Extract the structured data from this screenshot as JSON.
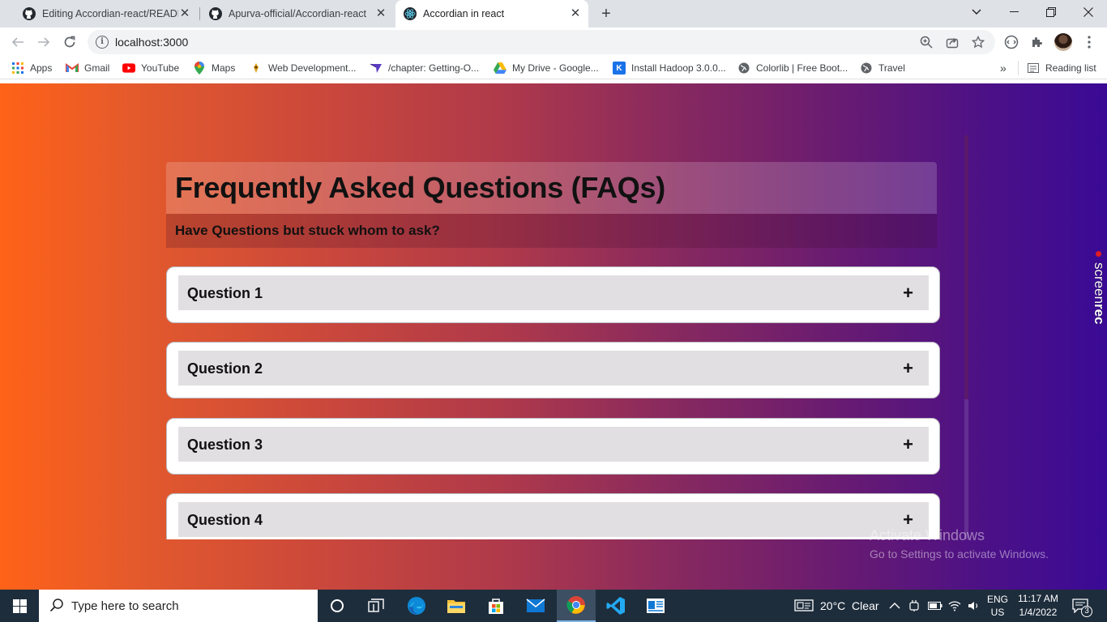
{
  "browser": {
    "tabs": [
      {
        "title": "Editing Accordian-react/READMI",
        "icon": "github-icon",
        "active": false
      },
      {
        "title": "Apurva-official/Accordian-react",
        "icon": "github-icon",
        "active": false
      },
      {
        "title": "Accordian in react",
        "icon": "react-icon",
        "active": true
      }
    ],
    "url": "localhost:3000",
    "bookmarks": [
      {
        "label": "Apps",
        "icon": "apps-grid-icon"
      },
      {
        "label": "Gmail",
        "icon": "gmail-icon"
      },
      {
        "label": "YouTube",
        "icon": "youtube-icon"
      },
      {
        "label": "Maps",
        "icon": "maps-pin-icon"
      },
      {
        "label": "Web Development...",
        "icon": "bookmark-favicon-icon"
      },
      {
        "label": "/chapter: Getting-O...",
        "icon": "bookmark-favicon-icon"
      },
      {
        "label": "My Drive - Google...",
        "icon": "google-drive-icon"
      },
      {
        "label": "Install Hadoop 3.0.0...",
        "icon": "k-favicon-icon"
      },
      {
        "label": "Colorlib | Free Boot...",
        "icon": "globe-icon"
      },
      {
        "label": "Travel",
        "icon": "globe-icon"
      }
    ],
    "reading_list": "Reading list"
  },
  "faq": {
    "title": "Frequently Asked Questions (FAQs)",
    "subtitle": "Have Questions but stuck whom to ask?",
    "questions": [
      {
        "label": "Question 1",
        "toggle": "+"
      },
      {
        "label": "Question 2",
        "toggle": "+"
      },
      {
        "label": "Question 3",
        "toggle": "+"
      },
      {
        "label": "Question 4",
        "toggle": "+"
      }
    ]
  },
  "overlay": {
    "screenrec_brand": "screen",
    "screenrec_brand_bold": "rec",
    "activate_title": "Activate Windows",
    "activate_sub": "Go to Settings to activate Windows."
  },
  "taskbar": {
    "search_placeholder": "Type here to search",
    "weather": "20°C  Clear",
    "lang_top": "ENG",
    "lang_bottom": "US",
    "time": "11:17 AM",
    "date": "1/4/2022",
    "notification_count": "3"
  },
  "colors": {
    "gradient_start": "#ff6218",
    "gradient_end": "#3a0a95",
    "question_bg": "#e2dfe2"
  }
}
